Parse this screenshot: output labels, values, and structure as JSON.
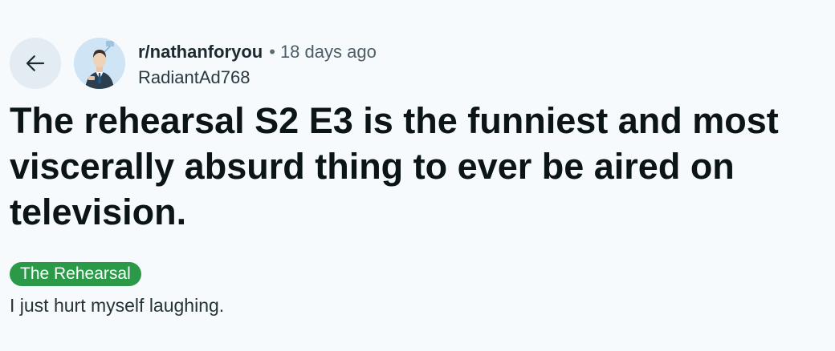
{
  "header": {
    "back_icon": "arrow-left-icon",
    "subreddit": "r/nathanforyou",
    "separator": "•",
    "age": "18 days ago",
    "author": "RadiantAd768"
  },
  "post": {
    "title": "The rehearsal S2 E3 is the funniest and most viscerally absurd thing to ever be aired on television.",
    "flair": "The Rehearsal",
    "flair_color": "#2b9a48",
    "body": "I just hurt myself laughing."
  }
}
